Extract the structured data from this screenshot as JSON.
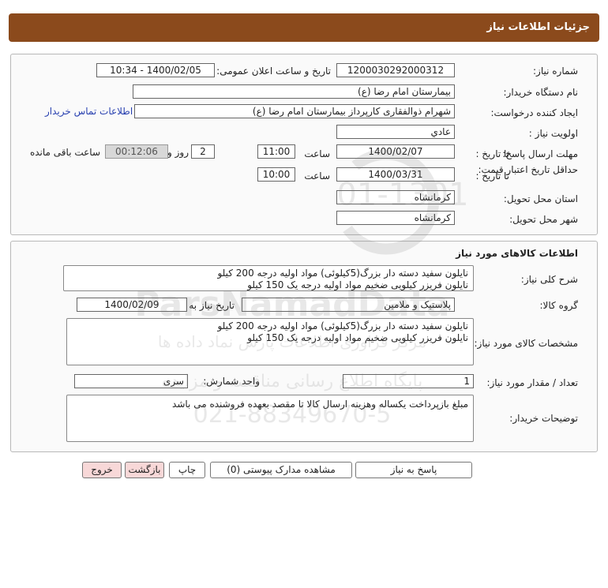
{
  "header": {
    "title": "جزئیات اطلاعات نیاز"
  },
  "form": {
    "need_number_label": "شماره نیاز:",
    "need_number": "1200030292000312",
    "announce_label": "تاریخ و ساعت اعلان عمومی:",
    "announce_value": "1400/02/05 - 10:34",
    "buyer_org_label": "نام دستگاه خریدار:",
    "buyer_org": "بیمارستان امام رضا (ع)",
    "creator_label": "ایجاد کننده درخواست:",
    "creator": "شهرام ذوالفقاری کارپرداز بیمارستان امام رضا (ع)",
    "contact_link": "اطلاعات تماس خریدار",
    "priority_label": "اولویت نیاز :",
    "priority": "عادي",
    "reply_deadline_label": "مهلت ارسال پاسخ:",
    "to_date_label": "تا تاریخ :",
    "reply_date": "1400/02/07",
    "time_label": "ساعت",
    "reply_time": "11:00",
    "days_value": "2",
    "days_label": "روز و",
    "remaining_time": "00:12:06",
    "remaining_label": "ساعت باقی مانده",
    "price_validity_label": "حداقل تاریخ اعتبار قیمت:",
    "price_to_date_label": "تا تاریخ :",
    "price_date": "1400/03/31",
    "price_time_label": "ساعت",
    "price_time": "10:00",
    "province_label": "استان محل تحویل:",
    "province": "کرمانشاه",
    "city_label": "شهر محل تحویل:",
    "city": "کرمانشاه"
  },
  "goods": {
    "section_title": "اطلاعات کالاهای مورد نیاز",
    "summary_label": "شرح کلی نیاز:",
    "summary": "نایلون سفید دسته دار بزرگ(5کیلوئی) مواد اولیه درجه 200 کیلو\nنایلون فریزر کیلویی ضخیم مواد اولیه درجه یک 150 کیلو",
    "group_label": "گروه کالا:",
    "group": "پلاستیک و ملامین",
    "need_date_label": "تاریخ نیاز به کالا:",
    "need_date": "1400/02/09",
    "specs_label": "مشخصات کالای مورد نیاز:",
    "specs": "نایلون سفید دسته دار بزرگ(5کیلوئی) مواد اولیه درجه 200 کیلو\nنایلون فریزر کیلویی ضخیم مواد اولیه درجه یک 150 کیلو",
    "qty_label": "تعداد / مقدار مورد نیاز:",
    "qty": "1",
    "unit_label": "واحد شمارش:",
    "unit": "سری",
    "notes_label": "توضیحات خریدار:",
    "notes": "مبلغ بازپرداخت یکساله وهزینه ارسال کالا تا مقصد بعهده فروشنده می باشد"
  },
  "buttons": {
    "reply": "پاسخ به نیاز",
    "attachments": "مشاهده مدارک پیوستی (0)",
    "print": "چاپ",
    "back": "بازگشت",
    "exit": "خروج"
  },
  "watermark": {
    "brand": "ParsNamadData",
    "line1": "مرکز فراوری اطلاعات پارس نماد داده ها",
    "line2": "پایگاه اطلاع رسانی مناقصه و مزایده",
    "phone": "021-88349670-5",
    "code": "01-1301"
  },
  "colors": {
    "titlebar": "#8b4a1c",
    "link": "#2840b0",
    "exit_button": "#f8d8d8"
  }
}
